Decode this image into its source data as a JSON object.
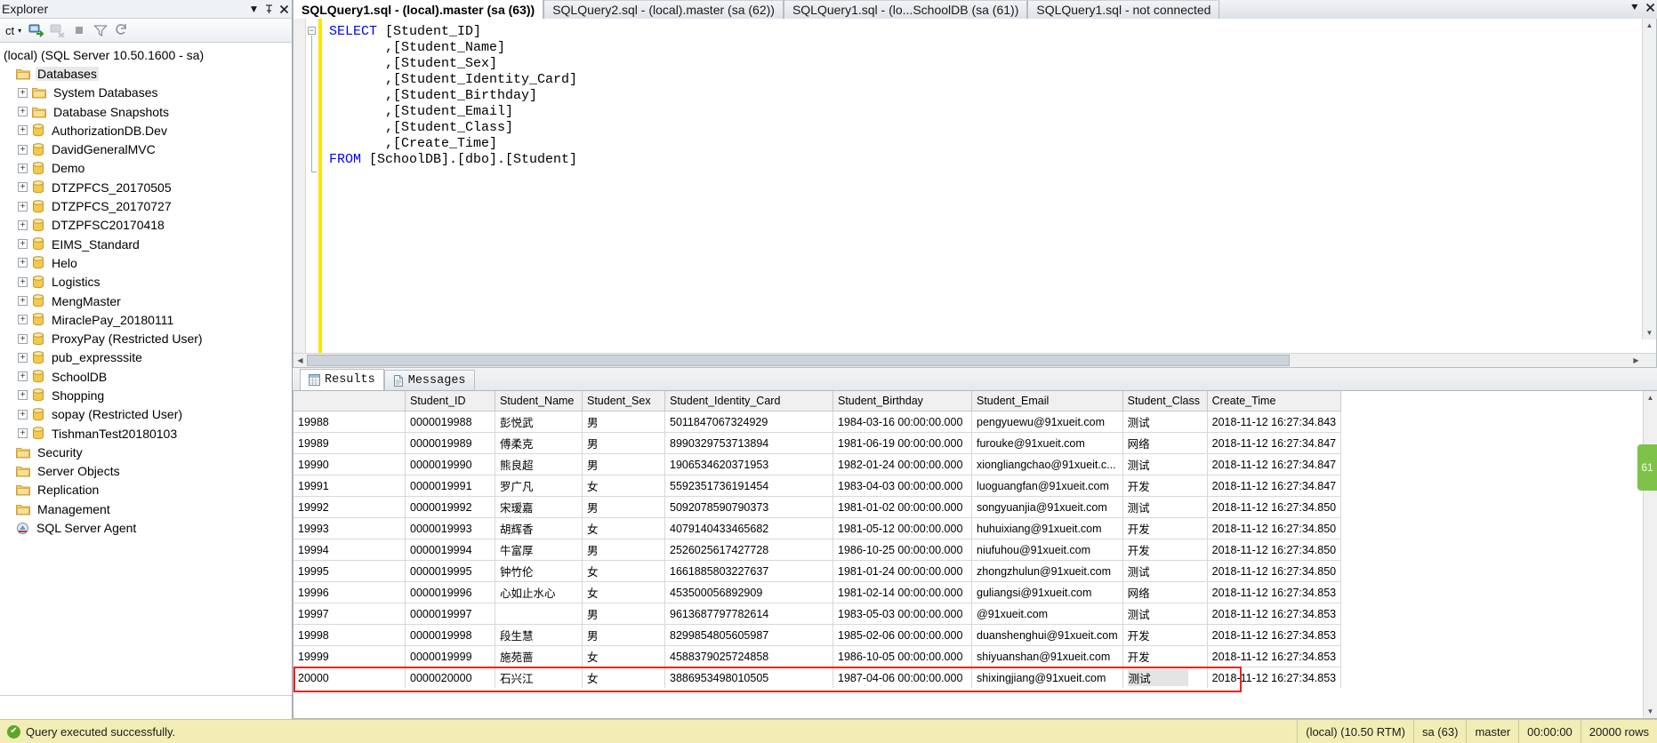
{
  "object_explorer": {
    "title": "Explorer",
    "header_buttons": [
      "dropdown",
      "pin",
      "close"
    ],
    "toolbar": {
      "connect_label": "ct",
      "icons": [
        "connect-icon",
        "disconnect-icon",
        "stop-icon",
        "filter-icon",
        "refresh-icon"
      ]
    },
    "root": "(local) (SQL Server 10.50.1600 - sa)",
    "items": [
      {
        "label": "Databases",
        "indent": 1,
        "icon": "folder-open",
        "expandable": false,
        "selected": true
      },
      {
        "label": "System Databases",
        "indent": 2,
        "icon": "folder",
        "expandable": true,
        "selected": false
      },
      {
        "label": "Database Snapshots",
        "indent": 2,
        "icon": "folder",
        "expandable": true,
        "selected": false
      },
      {
        "label": "AuthorizationDB.Dev",
        "indent": 2,
        "icon": "database",
        "expandable": true,
        "selected": false
      },
      {
        "label": "DavidGeneralMVC",
        "indent": 2,
        "icon": "database",
        "expandable": true,
        "selected": false
      },
      {
        "label": "Demo",
        "indent": 2,
        "icon": "database",
        "expandable": true,
        "selected": false
      },
      {
        "label": "DTZPFCS_20170505",
        "indent": 2,
        "icon": "database",
        "expandable": true,
        "selected": false
      },
      {
        "label": "DTZPFCS_20170727",
        "indent": 2,
        "icon": "database",
        "expandable": true,
        "selected": false
      },
      {
        "label": "DTZPFSC20170418",
        "indent": 2,
        "icon": "database",
        "expandable": true,
        "selected": false
      },
      {
        "label": "EIMS_Standard",
        "indent": 2,
        "icon": "database",
        "expandable": true,
        "selected": false
      },
      {
        "label": "Helo",
        "indent": 2,
        "icon": "database",
        "expandable": true,
        "selected": false
      },
      {
        "label": "Logistics",
        "indent": 2,
        "icon": "database",
        "expandable": true,
        "selected": false
      },
      {
        "label": "MengMaster",
        "indent": 2,
        "icon": "database",
        "expandable": true,
        "selected": false
      },
      {
        "label": "MiraclePay_20180111",
        "indent": 2,
        "icon": "database",
        "expandable": true,
        "selected": false
      },
      {
        "label": "ProxyPay (Restricted User)",
        "indent": 2,
        "icon": "database",
        "expandable": true,
        "selected": false
      },
      {
        "label": "pub_expresssite",
        "indent": 2,
        "icon": "database",
        "expandable": true,
        "selected": false
      },
      {
        "label": "SchoolDB",
        "indent": 2,
        "icon": "database",
        "expandable": true,
        "selected": false
      },
      {
        "label": "Shopping",
        "indent": 2,
        "icon": "database",
        "expandable": true,
        "selected": false
      },
      {
        "label": "sopay (Restricted User)",
        "indent": 2,
        "icon": "database",
        "expandable": true,
        "selected": false
      },
      {
        "label": "TishmanTest20180103",
        "indent": 2,
        "icon": "database",
        "expandable": true,
        "selected": false
      },
      {
        "label": "Security",
        "indent": 1,
        "icon": "folder",
        "expandable": false,
        "selected": false
      },
      {
        "label": "Server Objects",
        "indent": 1,
        "icon": "folder",
        "expandable": false,
        "selected": false
      },
      {
        "label": "Replication",
        "indent": 1,
        "icon": "folder",
        "expandable": false,
        "selected": false
      },
      {
        "label": "Management",
        "indent": 1,
        "icon": "folder",
        "expandable": false,
        "selected": false
      },
      {
        "label": "SQL Server Agent",
        "indent": 1,
        "icon": "agent",
        "expandable": false,
        "selected": false
      }
    ]
  },
  "editor_tabs": [
    {
      "label": "SQLQuery1.sql - (local).master (sa (63))",
      "active": true
    },
    {
      "label": "SQLQuery2.sql - (local).master (sa (62))",
      "active": false
    },
    {
      "label": "SQLQuery1.sql - (lo...SchoolDB (sa (61))",
      "active": false
    },
    {
      "label": "SQLQuery1.sql - not connected",
      "active": false
    }
  ],
  "tabstrip_buttons": [
    "tab-list-icon",
    "close-icon"
  ],
  "editor": {
    "lines": [
      {
        "kw": "SELECT",
        "rest": " [Student_ID]"
      },
      {
        "kw": "",
        "rest": "       ,[Student_Name]"
      },
      {
        "kw": "",
        "rest": "       ,[Student_Sex]"
      },
      {
        "kw": "",
        "rest": "       ,[Student_Identity_Card]"
      },
      {
        "kw": "",
        "rest": "       ,[Student_Birthday]"
      },
      {
        "kw": "",
        "rest": "       ,[Student_Email]"
      },
      {
        "kw": "",
        "rest": "       ,[Student_Class]"
      },
      {
        "kw": "",
        "rest": "       ,[Create_Time]"
      },
      {
        "kw": "FROM",
        "rest": " [SchoolDB].[dbo].[Student]"
      }
    ]
  },
  "results_tabs": [
    {
      "label": "Results",
      "icon": "grid-icon",
      "active": true
    },
    {
      "label": "Messages",
      "icon": "messages-icon",
      "active": false
    }
  ],
  "grid": {
    "columns": [
      "",
      "Student_ID",
      "Student_Name",
      "Student_Sex",
      "Student_Identity_Card",
      "Student_Birthday",
      "Student_Email",
      "Student_Class",
      "Create_Time"
    ],
    "rows": [
      [
        "19988",
        "0000019988",
        "彭悦武",
        "男",
        "5011847067324929",
        "1984-03-16 00:00:00.000",
        "pengyuewu@91xueit.com",
        "测试",
        "2018-11-12 16:27:34.843"
      ],
      [
        "19989",
        "0000019989",
        "傅柔克",
        "男",
        "8990329753713894",
        "1981-06-19 00:00:00.000",
        "furouke@91xueit.com",
        "网络",
        "2018-11-12 16:27:34.847"
      ],
      [
        "19990",
        "0000019990",
        "熊良超",
        "男",
        "1906534620371953",
        "1982-01-24 00:00:00.000",
        "xiongliangchao@91xueit.c...",
        "测试",
        "2018-11-12 16:27:34.847"
      ],
      [
        "19991",
        "0000019991",
        "罗广凡",
        "女",
        "5592351736191454",
        "1983-04-03 00:00:00.000",
        "luoguangfan@91xueit.com",
        "开发",
        "2018-11-12 16:27:34.847"
      ],
      [
        "19992",
        "0000019992",
        "宋瑷嘉",
        "男",
        "5092078590790373",
        "1981-01-02 00:00:00.000",
        "songyuanjia@91xueit.com",
        "测试",
        "2018-11-12 16:27:34.850"
      ],
      [
        "19993",
        "0000019993",
        "胡辉香",
        "女",
        "4079140433465682",
        "1981-05-12 00:00:00.000",
        "huhuixiang@91xueit.com",
        "开发",
        "2018-11-12 16:27:34.850"
      ],
      [
        "19994",
        "0000019994",
        "牛富厚",
        "男",
        "2526025617427728",
        "1986-10-25 00:00:00.000",
        "niufuhou@91xueit.com",
        "开发",
        "2018-11-12 16:27:34.850"
      ],
      [
        "19995",
        "0000019995",
        "钟竹伦",
        "女",
        "1661885803227637",
        "1981-01-24 00:00:00.000",
        "zhongzhulun@91xueit.com",
        "测试",
        "2018-11-12 16:27:34.850"
      ],
      [
        "19996",
        "0000019996",
        "心如止水心",
        "女",
        "453500056892909",
        "1981-02-14 00:00:00.000",
        "guliangsi@91xueit.com",
        "网络",
        "2018-11-12 16:27:34.853"
      ],
      [
        "19997",
        "0000019997",
        "",
        "男",
        "9613687797782614",
        "1983-05-03 00:00:00.000",
        "@91xueit.com",
        "测试",
        "2018-11-12 16:27:34.853"
      ],
      [
        "19998",
        "0000019998",
        "段生慧",
        "男",
        "8299854805605987",
        "1985-02-06 00:00:00.000",
        "duanshenghui@91xueit.com",
        "开发",
        "2018-11-12 16:27:34.853"
      ],
      [
        "19999",
        "0000019999",
        "施苑蔷",
        "女",
        "4588379025724858",
        "1986-10-05 00:00:00.000",
        "shiyuanshan@91xueit.com",
        "开发",
        "2018-11-12 16:27:34.853"
      ],
      [
        "20000",
        "0000020000",
        "石兴江",
        "女",
        "3886953498010505",
        "1987-04-06 00:00:00.000",
        "shixingjiang@91xueit.com",
        "测试",
        "2018-11-12 16:27:34.853"
      ]
    ],
    "highlight": {
      "row_index": 12,
      "color": "#e8251f",
      "selected_cell_col": 7
    }
  },
  "status_bar": {
    "message": "Query executed successfully.",
    "server": "(local) (10.50 RTM)",
    "login": "sa (63)",
    "database": "master",
    "elapsed": "00:00:00",
    "rows": "20000 rows"
  },
  "side_badge": "61",
  "colors": {
    "keyword": "#0000ff",
    "change_bar": "#ffe400",
    "status_bg": "#f2edb4",
    "highlight": "#e8251f",
    "success": "#5ea52b"
  }
}
